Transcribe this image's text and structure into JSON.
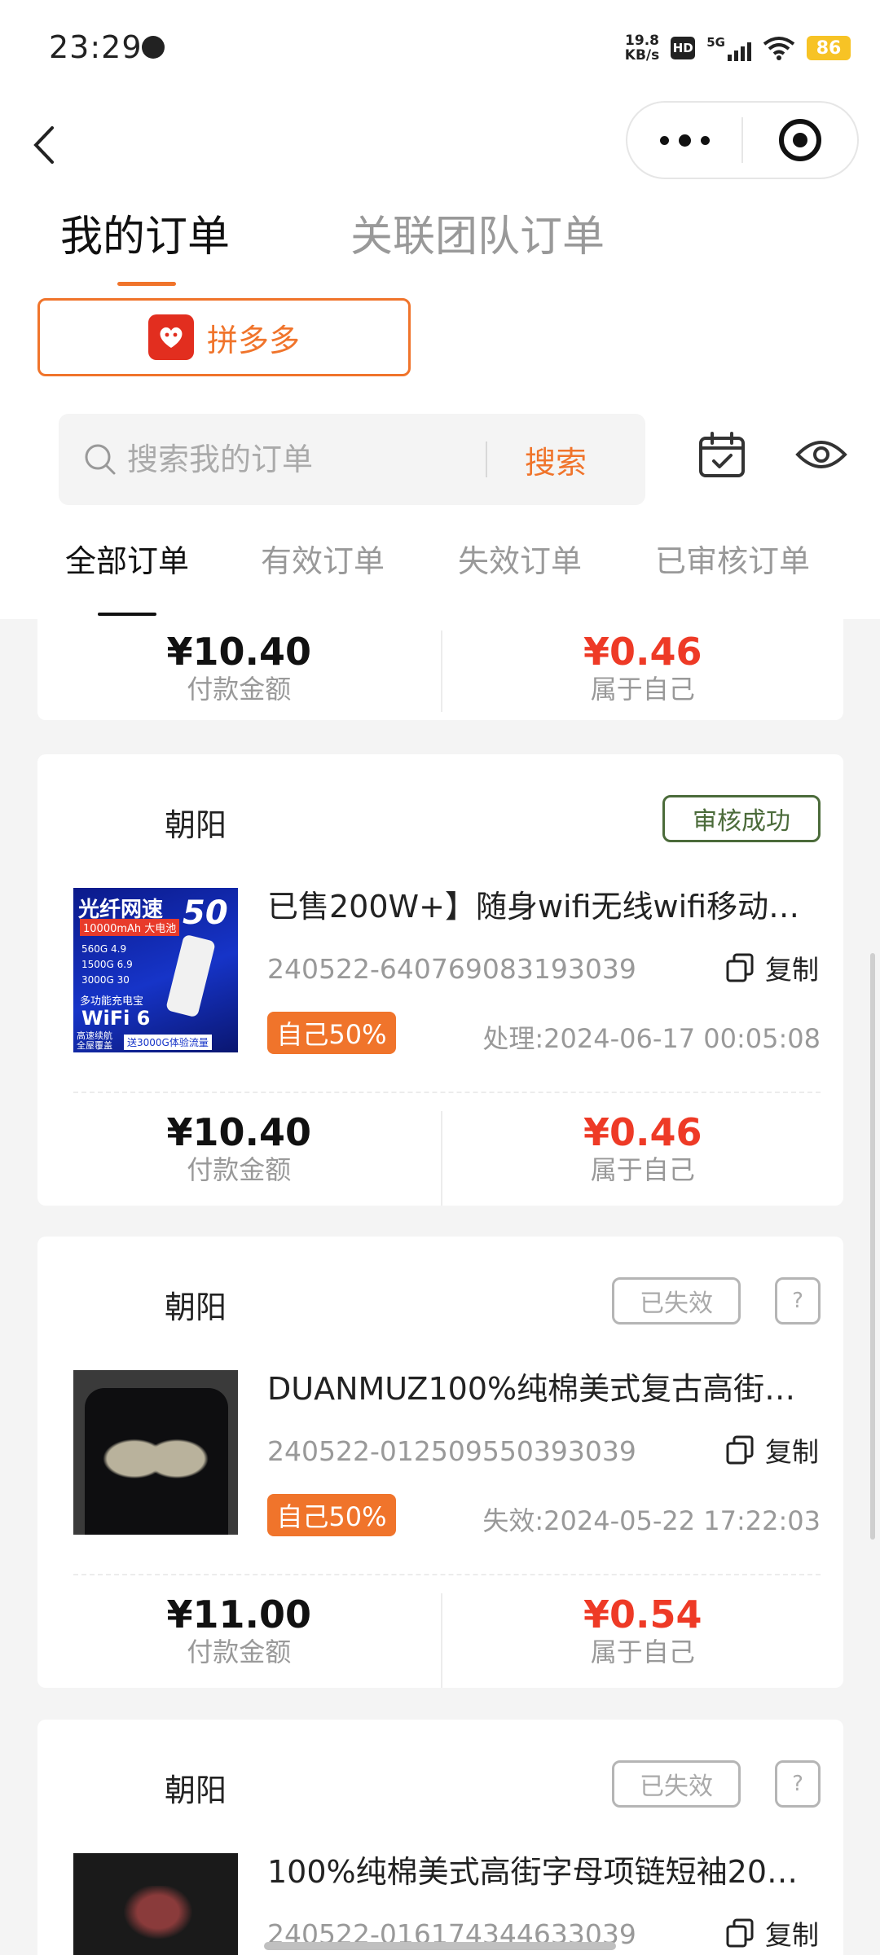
{
  "status_bar": {
    "time": "23:29",
    "speed": "19.8",
    "speed_unit": "KB/s",
    "hd_label": "HD",
    "net_label": "5G",
    "battery": "86"
  },
  "tabs": {
    "main": [
      "我的订单",
      "关联团队订单"
    ],
    "status": [
      "全部订单",
      "有效订单",
      "失效订单",
      "已审核订单"
    ]
  },
  "platform": {
    "label": "拼多多"
  },
  "search": {
    "placeholder": "搜索我的订单",
    "button": "搜索"
  },
  "common": {
    "copy_label": "复制",
    "help_label": "?",
    "pay_label": "付款金额",
    "own_label": "属于自己"
  },
  "partial_card": {
    "pay_amount": "¥10.40",
    "commission": "¥0.46"
  },
  "orders": [
    {
      "shop": "朝阳",
      "status": "审核成功",
      "title": "已售200W+】随身wifi无线wifi移动…",
      "order_no": "240522-640769083193039",
      "share": "自己50%",
      "time": "处理:2024-06-17 00:05:08",
      "pay_amount": "¥10.40",
      "commission": "¥0.46",
      "thumb_text": [
        "光纤网速",
        "10000mAh 大电池",
        "50",
        "560G 4.9",
        "1500G 6.9",
        "3000G 30",
        "多功能充电宝",
        "WiFi 6",
        "高速续航",
        "全屋覆盖",
        "送3000G体验流量"
      ]
    },
    {
      "shop": "朝阳",
      "status": "已失效",
      "title": "DUANMUZ100%纯棉美式复古高街…",
      "order_no": "240522-012509550393039",
      "share": "自己50%",
      "time": "失效:2024-05-22 17:22:03",
      "pay_amount": "¥11.00",
      "commission": "¥0.54"
    },
    {
      "shop": "朝阳",
      "status": "已失效",
      "title": "100%纯棉美式高街字母项链短袖202…",
      "order_no": "240522-016174344633039"
    }
  ],
  "colors": {
    "accent": "#f0742b",
    "price_red": "#ee3a26",
    "success": "#4b6b3a",
    "pdd_red": "#e22e1f"
  }
}
